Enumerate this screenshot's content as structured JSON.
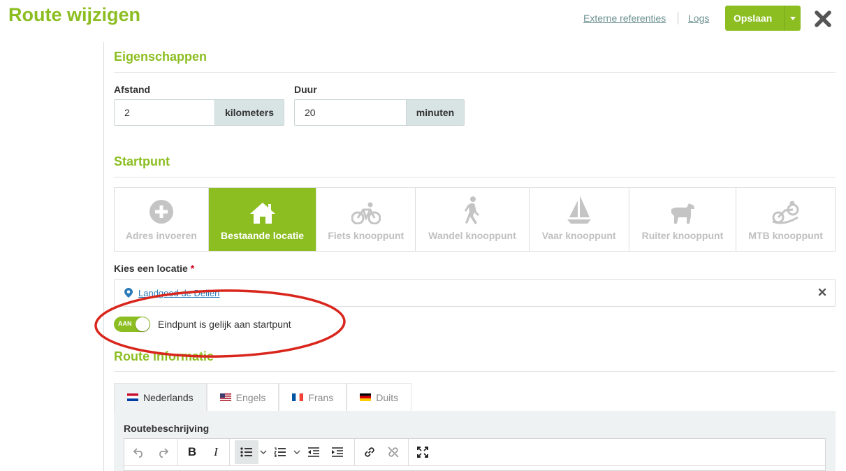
{
  "header": {
    "title": "Route wijzigen",
    "links": {
      "external": "Externe referenties",
      "logs": "Logs"
    },
    "save_label": "Opslaan"
  },
  "properties": {
    "title": "Eigenschappen",
    "distance": {
      "label": "Afstand",
      "value": "2",
      "unit": "kilometers"
    },
    "duration": {
      "label": "Duur",
      "value": "20",
      "unit": "minuten"
    }
  },
  "start": {
    "title": "Startpunt",
    "types": [
      {
        "label": "Adres invoeren",
        "icon": "plus-circle-icon",
        "active": false
      },
      {
        "label": "Bestaande locatie",
        "icon": "home-icon",
        "active": true
      },
      {
        "label": "Fiets knooppunt",
        "icon": "bicycle-icon",
        "active": false
      },
      {
        "label": "Wandel knooppunt",
        "icon": "walking-icon",
        "active": false
      },
      {
        "label": "Vaar knooppunt",
        "icon": "sailboat-icon",
        "active": false
      },
      {
        "label": "Ruiter knooppunt",
        "icon": "horse-icon",
        "active": false
      },
      {
        "label": "MTB knooppunt",
        "icon": "mountain-bike-icon",
        "active": false
      }
    ],
    "location_label": "Kies een locatie",
    "required_mark": "*",
    "location_value": "Landgoed de Dellen",
    "toggle": {
      "state": "AAN",
      "label": "Eindpunt is gelijk aan startpunt"
    }
  },
  "route_info": {
    "title": "Route informatie",
    "tabs": [
      {
        "label": "Nederlands",
        "flag": "nl",
        "active": true
      },
      {
        "label": "Engels",
        "flag": "us",
        "active": false
      },
      {
        "label": "Frans",
        "flag": "fr",
        "active": false
      },
      {
        "label": "Duits",
        "flag": "de",
        "active": false
      }
    ],
    "editor_label": "Routebeschrijving"
  },
  "colors": {
    "accent": "#8cbe22",
    "link": "#2a7ab8",
    "annotation": "#d9261c",
    "addon": "#d8e4e4"
  }
}
